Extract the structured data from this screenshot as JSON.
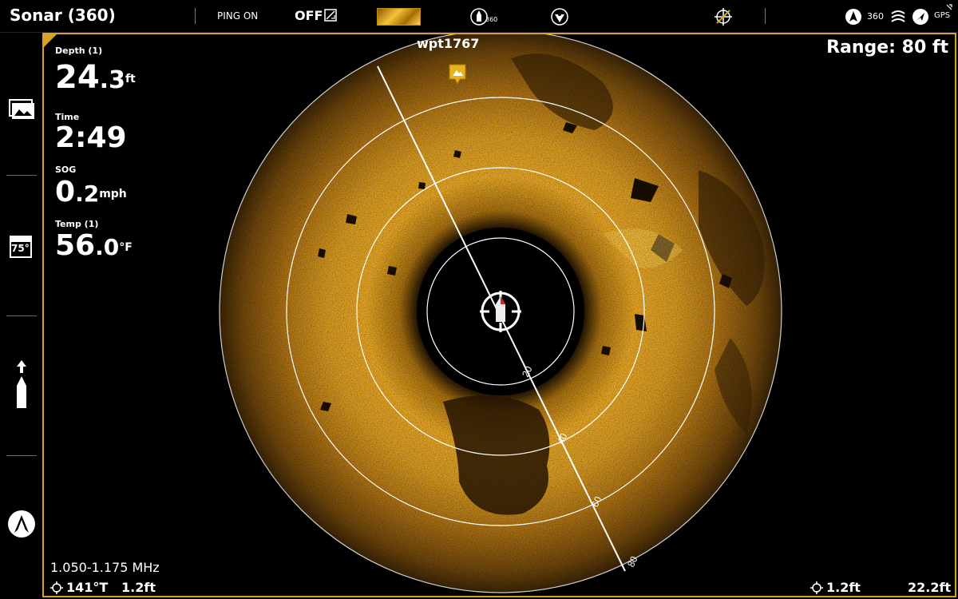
{
  "app": {
    "title": "Sonar (360)"
  },
  "topbar": {
    "ping_status": "PING ON",
    "off_label": "OFF",
    "badge_360": "360",
    "status_360": "360",
    "gps_label": "GPS",
    "icons": [
      "off-toggle-icon",
      "chart-thumbnail-icon",
      "boat-360-icon",
      "transducer-icon",
      "crosshair-off-icon",
      "compass-icon",
      "360-icon",
      "sonar-stack-icon",
      "navigation-icon",
      "gps-icon"
    ]
  },
  "sidebar": {
    "items": [
      {
        "icon": "gallery-icon"
      },
      {
        "icon": "temperature-icon",
        "label": "75°"
      },
      {
        "icon": "boat-forward-icon"
      },
      {
        "icon": "home-menu-icon"
      }
    ]
  },
  "digital_readouts": {
    "depth": {
      "label": "Depth (1)",
      "whole": "24",
      "decimal": ".3",
      "unit": "ft"
    },
    "time": {
      "label": "Time",
      "value": "2:49"
    },
    "sog": {
      "label": "SOG",
      "whole": "0",
      "decimal": ".2",
      "unit": "mph"
    },
    "temp": {
      "label": "Temp (1)",
      "whole": "56",
      "decimal": ".0",
      "unit": "°F"
    }
  },
  "sonar": {
    "waypoint_label": "wpt1767",
    "range_label": "Range: 80 ft",
    "range_rings": [
      "20",
      "40",
      "60",
      "80"
    ],
    "colors": {
      "accent": "#d9a227",
      "echo_bright": "#f0b42a",
      "echo_dark": "#5a3a08"
    }
  },
  "status": {
    "frequency": "1.050-1.175 MHz",
    "heading": "141°T",
    "heading_offset": "1.2ft",
    "cursor_offset": "1.2ft",
    "cursor_distance": "22.2ft"
  }
}
